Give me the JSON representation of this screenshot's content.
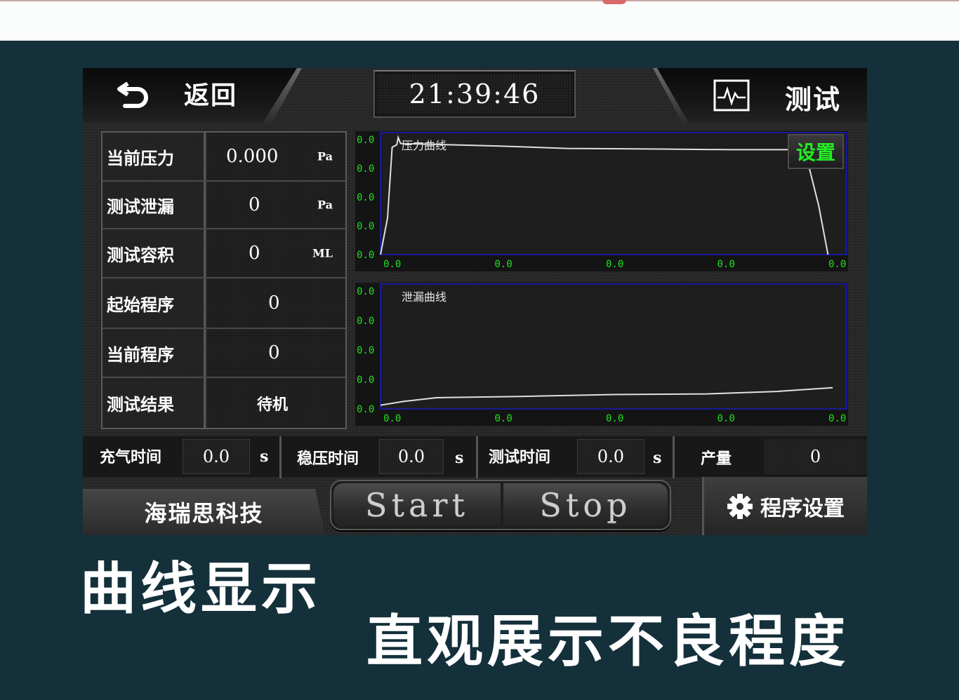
{
  "header": {
    "back_label": "返回",
    "clock": "21:39:46",
    "mode_label": "测试"
  },
  "params": [
    {
      "label": "当前压力",
      "value": "0.000",
      "unit": "Pa"
    },
    {
      "label": "测试泄漏",
      "value": "0",
      "unit": "Pa"
    },
    {
      "label": "测试容积",
      "value": "0",
      "unit": "ML"
    },
    {
      "label": "起始程序",
      "value": "0",
      "unit": ""
    },
    {
      "label": "当前程序",
      "value": "0",
      "unit": ""
    },
    {
      "label": "测试结果",
      "value": "待机",
      "unit": ""
    }
  ],
  "charts": {
    "settings_label": "设置",
    "pressure": {
      "title": "压力曲线",
      "y_tick_labels": [
        "0.0",
        "0.0",
        "0.0",
        "0.0",
        "0.0"
      ],
      "x_tick_labels": [
        "0.0",
        "0.0",
        "0.0",
        "0.0",
        "0.0"
      ],
      "line_color": "#e0e0e0",
      "grid_color": "#1a1a9a",
      "points": [
        [
          0,
          0
        ],
        [
          1.5,
          0.3
        ],
        [
          2.5,
          0.88
        ],
        [
          3.5,
          0.9
        ],
        [
          3.8,
          0.96
        ],
        [
          4.3,
          0.91
        ],
        [
          10,
          0.905
        ],
        [
          25,
          0.89
        ],
        [
          40,
          0.87
        ],
        [
          60,
          0.865
        ],
        [
          75,
          0.86
        ],
        [
          91,
          0.86
        ],
        [
          94,
          0.4
        ],
        [
          96,
          0
        ]
      ]
    },
    "leakage": {
      "title": "泄漏曲线",
      "y_tick_labels": [
        "0.0",
        "0.0",
        "0.0",
        "0.0",
        "0.0"
      ],
      "x_tick_labels": [
        "0.0",
        "0.0",
        "0.0",
        "0.0",
        "0.0"
      ],
      "line_color": "#e0e0e0",
      "grid_color": "#1a1a9a",
      "points": [
        [
          0,
          0.03
        ],
        [
          5,
          0.06
        ],
        [
          12,
          0.09
        ],
        [
          30,
          0.1
        ],
        [
          50,
          0.115
        ],
        [
          70,
          0.12
        ],
        [
          85,
          0.14
        ],
        [
          97,
          0.17
        ]
      ]
    }
  },
  "info_bar": {
    "inflate": {
      "label": "充气时间",
      "value": "0.0",
      "unit": "s"
    },
    "stabilize": {
      "label": "稳压时间",
      "value": "0.0",
      "unit": "s"
    },
    "test": {
      "label": "测试时间",
      "value": "0.0",
      "unit": "s"
    },
    "output": {
      "label": "产量",
      "value": "0"
    }
  },
  "footer": {
    "brand": "海瑞思科技",
    "start_label": "Start",
    "stop_label": "Stop",
    "program_settings_label": "程序设置"
  },
  "captions": {
    "line1": "曲线显示",
    "line2": "直观展示不良程度"
  }
}
